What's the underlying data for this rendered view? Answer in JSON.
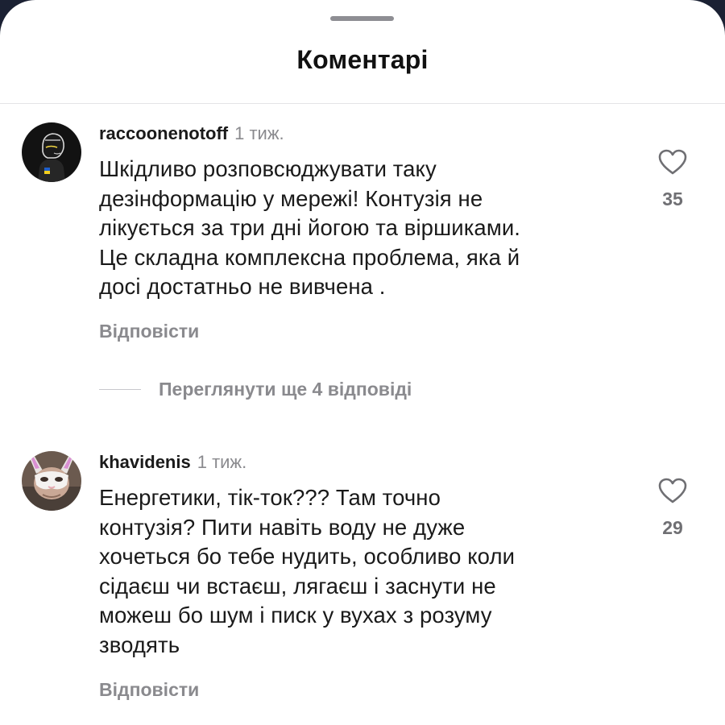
{
  "sheet": {
    "title": "Коментарі"
  },
  "comments": [
    {
      "username": "raccoonenotoff",
      "time": "1 тиж.",
      "lines": [
        "Шкідливо розповсюджувати таку",
        "дезінформацію у мережі! Контузія не",
        "лікується за три дні йогою та віршиками.",
        "Це складна комплексна проблема, яка й",
        "досі достатньо не вивчена ."
      ],
      "likes": "35",
      "reply_label": "Відповісти",
      "view_replies_label": "Переглянути ще 4 відповіді"
    },
    {
      "username": "khavidenis",
      "time": "1 тиж.",
      "lines": [
        "Енергетики, тік-ток??? Там точно",
        "контузія? Пити навіть воду не дуже",
        "хочеться бо тебе нудить, особливо коли",
        "сідаєш чи встаєш, лягаєш і заснути не",
        "можеш бо шум і писк у вухах з розуму",
        "зводять"
      ],
      "likes": "29",
      "reply_label": "Відповісти"
    }
  ],
  "colors": {
    "text": "#1a1a1a",
    "secondary": "#8a8a8e",
    "background": "#ffffff",
    "ukraine_blue": "#1f5fc9",
    "ukraine_yellow": "#f4cf1e"
  }
}
